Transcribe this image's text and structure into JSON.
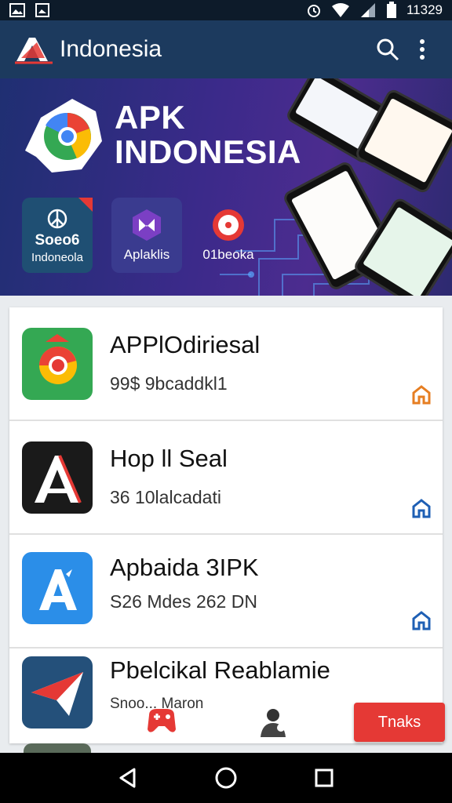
{
  "status_bar": {
    "time": "11329",
    "icons": [
      "image-icon",
      "gallery-icon",
      "alarm-icon",
      "wifi-icon",
      "signal-icon",
      "battery-icon"
    ]
  },
  "app_bar": {
    "title": "Indonesia",
    "icons": [
      "apk-logo-icon",
      "search-icon",
      "more-vert-icon"
    ]
  },
  "banner": {
    "title_line1": "APK",
    "title_line2": "INDONESIA",
    "tiles": [
      {
        "top": "Soeo6",
        "label": "Indoneola",
        "icon": "peace-icon",
        "color": "#1f4f73"
      },
      {
        "label": "Aplaklis",
        "icon": "bowtie-icon",
        "color": "#3a3b8f"
      },
      {
        "label": "01beoka",
        "icon": "record-icon",
        "color": "transparent"
      }
    ]
  },
  "apps": [
    {
      "title": "APPlOdiriesal",
      "subtitle": "99$ 9bcaddkl1",
      "icon": "chrome-like-icon",
      "action": "home-icon",
      "action_color": "#e67e22"
    },
    {
      "title": "Hop ll Seal",
      "subtitle": "36 10lalcadati",
      "icon": "a-logo-dark-icon",
      "action": "home-icon",
      "action_color": "#1e5fb4"
    },
    {
      "title": "Apbaida 3IPK",
      "subtitle": "S26 Mdes 262 DN",
      "icon": "app-store-icon",
      "action": "home-icon",
      "action_color": "#1e5fb4"
    },
    {
      "title": "Pbelcikal Reablamie",
      "subtitle": "Snoo... Maron",
      "icon": "paper-plane-icon",
      "action": "",
      "action_color": ""
    }
  ],
  "floating": {
    "try_label": "Tnaks",
    "try_color": "#e53935"
  },
  "nav_bar": {
    "icons": [
      "back-icon",
      "home-circle-icon",
      "recents-icon"
    ]
  }
}
